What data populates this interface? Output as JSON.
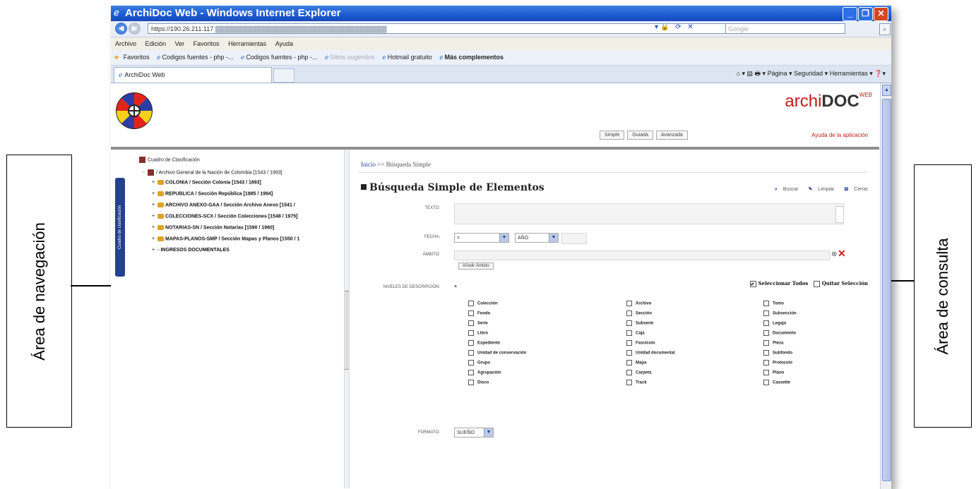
{
  "window": {
    "title": "ArchiDoc Web - Windows Internet Explorer",
    "url_visible": "https://190.26.211.117",
    "search_placeholder": "Google"
  },
  "menubar": [
    "Archivo",
    "Edición",
    "Ver",
    "Favoritos",
    "Herramientas",
    "Ayuda"
  ],
  "favorites": {
    "label": "Favoritos",
    "links": [
      "Codigos fuentes - php -...",
      "Codigos fuentes - php -...",
      "Sitios sugeridos",
      "Hotmail gratuito",
      "Más complementos"
    ]
  },
  "tab": {
    "label": "ArchiDoc Web"
  },
  "commandbar": {
    "items": [
      "Página",
      "Seguridad",
      "Herramientas"
    ]
  },
  "header": {
    "brand_a": "archi",
    "brand_b": "DOC",
    "brand_sup": "WEB",
    "help": "Ayuda de la aplicación",
    "modes": [
      "Simple",
      "Guiada",
      "Avanzada"
    ]
  },
  "tree": {
    "side_tab": "Cuadro de clasificación",
    "root": "Cuadro de Clasificación",
    "items": [
      "/ Archivo General de la Nación de Colombia [1543 / 1993]",
      "COLONIA / Sección Colonia [1543 / 1893]",
      "REPUBLICA / Sección República [1885 / 1994]",
      "ARCHIVO ANEXO-GAA / Sección Archivo Anexo [1541 /",
      "COLECCIONES-SCX / Sección Colecciones [1548 / 1975]",
      "NOTARIAS-SN / Sección Notarías [1590 / 1960]",
      "MAPAS-PLANOS-SMP / Sección Mapas y Planos [1550 / 1",
      "INGRESOS DOCUMENTALES"
    ]
  },
  "query": {
    "breadcrumb_home": "Inicio",
    "breadcrumb_sep": ">>",
    "breadcrumb_current": "Búsqueda Simple",
    "title": "Búsqueda Simple de Elementos",
    "actions": [
      "Buscar",
      "Limpiar",
      "Cerrar"
    ],
    "labels": {
      "texto": "TEXTO:",
      "fecha": "FECHA:",
      "ambito": "ÁMBITO:",
      "niveles": "NIVELES DE DESCRIPCIÓN:",
      "formato": "FORMATO:"
    },
    "fecha_op": "=",
    "fecha_unit": "AÑO",
    "anadir_button": "Añadir Ámbito",
    "select_all": "Seleccionar Todos",
    "clear_selection": "Quitar Selección",
    "format_value": "SUEÑO",
    "levels": [
      [
        "Colección",
        "Fondo",
        "Serie",
        "Libro",
        "Expediente",
        "Unidad de conservación",
        "Grupo",
        "Agrupación",
        "Disco"
      ],
      [
        "Archivo",
        "Sección",
        "Subserie",
        "Caja",
        "Fascículo",
        "Unidad documental",
        "Mapa",
        "Carpeta",
        "Track"
      ],
      [
        "Tomo",
        "Subsección",
        "Legajo",
        "Documento",
        "Pieza",
        "Subfondo",
        "Protocolo",
        "Plano",
        "Cassette"
      ]
    ]
  },
  "annotations": {
    "left": "Área de navegación",
    "right": "Área de consulta"
  }
}
